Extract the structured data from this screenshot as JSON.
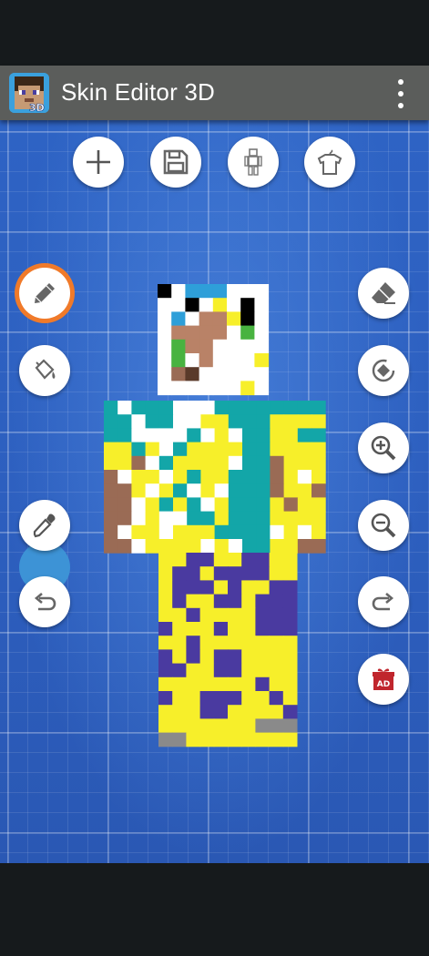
{
  "app": {
    "title": "Skin Editor 3D",
    "icon": "steve-head-3d-logo",
    "icon_badge": "3D"
  },
  "top_toolbar": [
    {
      "icon": "plus-icon",
      "action": "new skin"
    },
    {
      "icon": "save-icon",
      "action": "save"
    },
    {
      "icon": "body-parts-icon",
      "action": "body parts"
    },
    {
      "icon": "shirt-hanger-icon",
      "action": "wardrobe"
    }
  ],
  "left_tools": [
    {
      "icon": "pencil-icon",
      "selected": true
    },
    {
      "icon": "bucket-fill-icon",
      "selected": false
    },
    {
      "icon": "current-color-swatch"
    },
    {
      "icon": "eyedropper-icon",
      "selected": false
    },
    {
      "icon": "undo-icon"
    }
  ],
  "right_tools": [
    {
      "icon": "eraser-icon"
    },
    {
      "icon": "rotate-icon"
    },
    {
      "icon": "zoom-in-icon"
    },
    {
      "icon": "zoom-out-icon"
    },
    {
      "icon": "redo-icon"
    },
    {
      "icon": "gift-ad-icon",
      "badge": "AD"
    }
  ],
  "colors": {
    "current_color": "#3d93d6",
    "selection_ring": "#f07a2a",
    "app_bar": "#5b5d5b",
    "canvas_blue": "#2e63c4"
  }
}
